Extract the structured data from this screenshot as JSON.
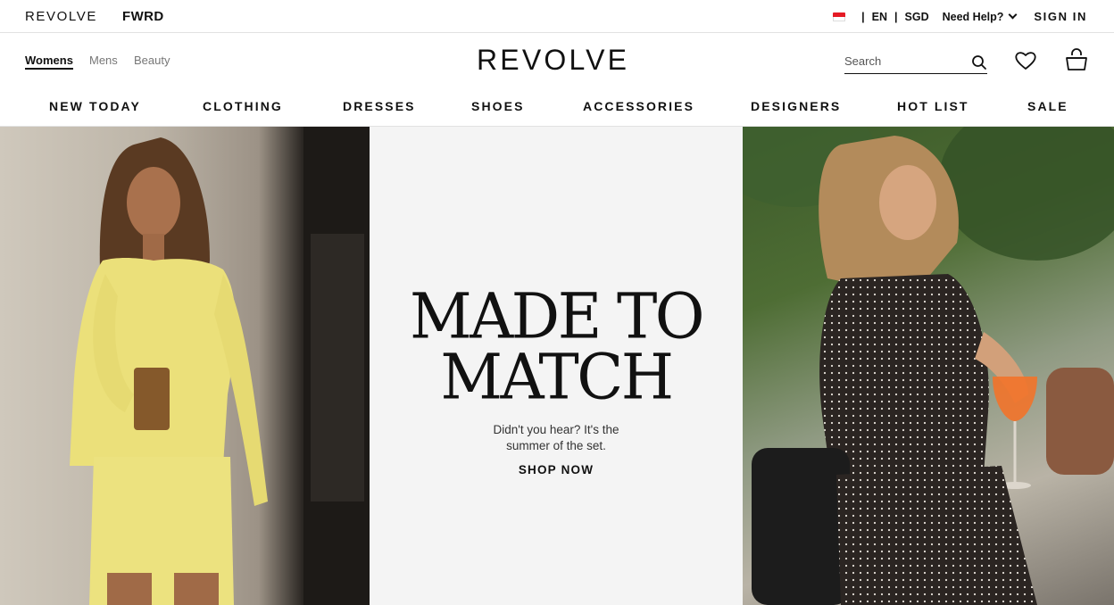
{
  "utility_bar": {
    "brand_revolve": "REVOLVE",
    "brand_fwrd": "FWRD",
    "language": "EN",
    "currency": "SGD",
    "separator": "|",
    "need_help": "Need Help?",
    "sign_in": "SIGN IN"
  },
  "header": {
    "tabs": [
      {
        "label": "Womens",
        "active": true
      },
      {
        "label": "Mens",
        "active": false
      },
      {
        "label": "Beauty",
        "active": false
      }
    ],
    "logo": "REVOLVE",
    "search_placeholder": "Search"
  },
  "categories": [
    "NEW TODAY",
    "CLOTHING",
    "DRESSES",
    "SHOES",
    "ACCESSORIES",
    "DESIGNERS",
    "HOT LIST",
    "SALE"
  ],
  "hero": {
    "headline_line1": "MADE TO",
    "headline_line2": "MATCH",
    "sub_line1": "Didn't you hear? It's the",
    "sub_line2": "summer of the set.",
    "cta": "SHOP NOW"
  },
  "icons": {
    "flag": "singapore-flag-icon",
    "search": "search-icon",
    "wishlist": "heart-icon",
    "bag": "shopping-bag-icon",
    "chevron": "chevron-down-icon"
  },
  "colors": {
    "text": "#111111",
    "muted": "#777777",
    "hero_mid_bg": "#f4f4f4",
    "flag_red": "#e51b25"
  }
}
